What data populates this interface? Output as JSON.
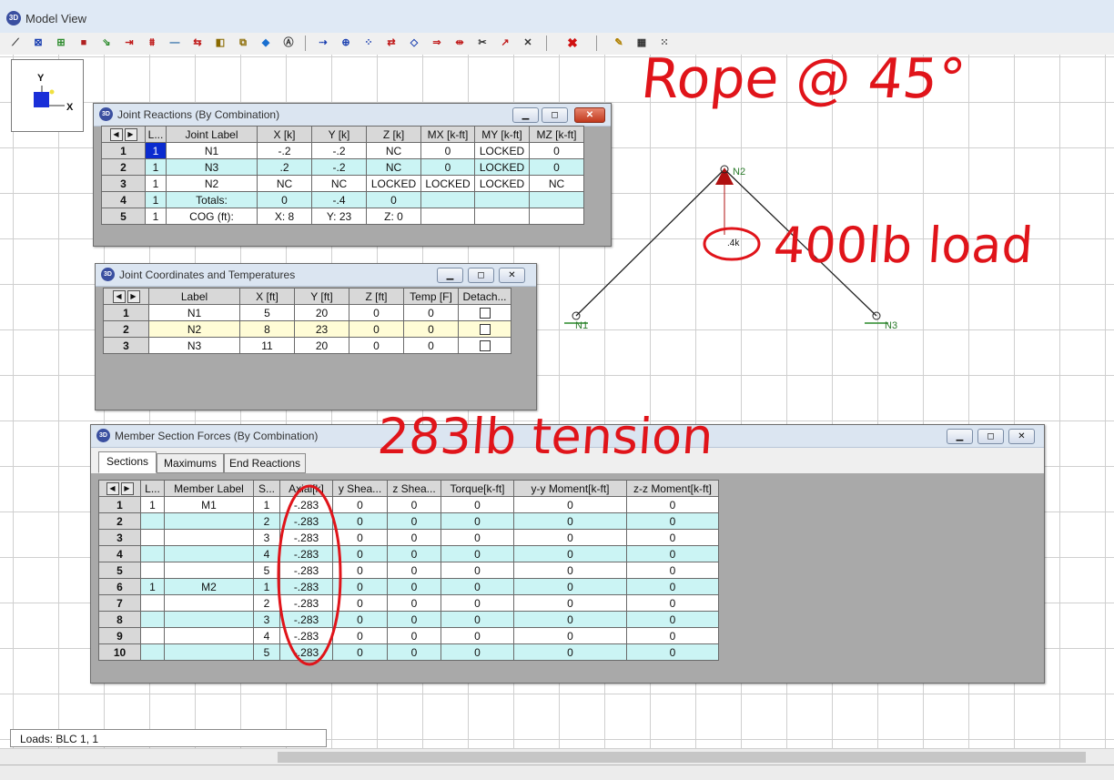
{
  "window": {
    "title": "Model View"
  },
  "colors": {
    "accent": "#0a2bcf",
    "cyan_row": "#cbf4f4",
    "yellow_row": "#fffcd6",
    "annotation": "#e0141a",
    "load_arrow": "#b01010"
  },
  "toolbar": {
    "icons": [
      "draw-member-icon",
      "select-icon",
      "plate-icon",
      "solid-icon",
      "boundary-icon",
      "load-arrow-icon",
      "distributed-load-icon",
      "line-icon",
      "move-icon",
      "mirror-icon",
      "copy-icon",
      "render-icon",
      "snap-icon",
      "node-icon",
      "node-plus-icon",
      "joint-icon",
      "a-to-a-icon",
      "a-diamond-icon",
      "a-arrow-icon",
      "a-bar-icon",
      "scissors-icon",
      "wand-icon",
      "cross-icon",
      "delete-icon",
      "edit-icon",
      "grid-icon",
      "dot-grid-icon"
    ]
  },
  "axes": {
    "y": "Y",
    "x": "X"
  },
  "joint_reactions": {
    "title": "Joint Reactions (By Combination)",
    "columns": [
      "L...",
      "Joint Label",
      "X [k]",
      "Y [k]",
      "Z [k]",
      "MX [k-ft]",
      "MY [k-ft]",
      "MZ [k-ft]"
    ],
    "rows": [
      {
        "n": "1",
        "cells": [
          "1",
          "N1",
          "-.2",
          "-.2",
          "NC",
          "0",
          "LOCKED",
          "0"
        ]
      },
      {
        "n": "2",
        "cells": [
          "1",
          "N3",
          ".2",
          "-.2",
          "NC",
          "0",
          "LOCKED",
          "0"
        ]
      },
      {
        "n": "3",
        "cells": [
          "1",
          "N2",
          "NC",
          "NC",
          "LOCKED",
          "LOCKED",
          "LOCKED",
          "NC"
        ]
      },
      {
        "n": "4",
        "cells": [
          "1",
          "Totals:",
          "0",
          "-.4",
          "0",
          "",
          "",
          ""
        ]
      },
      {
        "n": "5",
        "cells": [
          "1",
          "COG (ft):",
          "X: 8",
          "Y: 23",
          "Z: 0",
          "",
          "",
          ""
        ]
      }
    ]
  },
  "joint_coords": {
    "title": "Joint Coordinates and Temperatures",
    "columns": [
      "Label",
      "X [ft]",
      "Y [ft]",
      "Z [ft]",
      "Temp [F]",
      "Detach..."
    ],
    "rows": [
      {
        "n": "1",
        "cells": [
          "N1",
          "5",
          "20",
          "0",
          "0"
        ],
        "detach": false
      },
      {
        "n": "2",
        "cells": [
          "N2",
          "8",
          "23",
          "0",
          "0"
        ],
        "detach": false
      },
      {
        "n": "3",
        "cells": [
          "N3",
          "11",
          "20",
          "0",
          "0"
        ],
        "detach": false
      }
    ]
  },
  "member_forces": {
    "title": "Member Section Forces (By Combination)",
    "tabs": [
      "Sections",
      "Maximums",
      "End Reactions"
    ],
    "columns": [
      "L...",
      "Member Label",
      "S...",
      "Axial[k]",
      "y Shea...",
      "z Shea...",
      "Torque[k-ft]",
      "y-y Moment[k-ft]",
      "z-z Moment[k-ft]"
    ],
    "rows": [
      {
        "n": "1",
        "cells": [
          "1",
          "M1",
          "1",
          "-.283",
          "0",
          "0",
          "0",
          "0",
          "0"
        ]
      },
      {
        "n": "2",
        "cells": [
          "",
          "",
          "2",
          "-.283",
          "0",
          "0",
          "0",
          "0",
          "0"
        ]
      },
      {
        "n": "3",
        "cells": [
          "",
          "",
          "3",
          "-.283",
          "0",
          "0",
          "0",
          "0",
          "0"
        ]
      },
      {
        "n": "4",
        "cells": [
          "",
          "",
          "4",
          "-.283",
          "0",
          "0",
          "0",
          "0",
          "0"
        ]
      },
      {
        "n": "5",
        "cells": [
          "",
          "",
          "5",
          "-.283",
          "0",
          "0",
          "0",
          "0",
          "0"
        ]
      },
      {
        "n": "6",
        "cells": [
          "1",
          "M2",
          "1",
          "-.283",
          "0",
          "0",
          "0",
          "0",
          "0"
        ]
      },
      {
        "n": "7",
        "cells": [
          "",
          "",
          "2",
          "-.283",
          "0",
          "0",
          "0",
          "0",
          "0"
        ]
      },
      {
        "n": "8",
        "cells": [
          "",
          "",
          "3",
          "-.283",
          "0",
          "0",
          "0",
          "0",
          "0"
        ]
      },
      {
        "n": "9",
        "cells": [
          "",
          "",
          "4",
          "-.283",
          "0",
          "0",
          "0",
          "0",
          "0"
        ]
      },
      {
        "n": "10",
        "cells": [
          "",
          "",
          "5",
          "-.283",
          "0",
          "0",
          "0",
          "0",
          "0"
        ]
      }
    ]
  },
  "model": {
    "nodes": [
      "N1",
      "N2",
      "N3"
    ],
    "load_label": ".4k"
  },
  "annotations": {
    "rope": "Rope @ 45°",
    "load": "400lb load",
    "tension": "283lb tension"
  },
  "status": {
    "loads": "Loads: BLC 1, 1"
  }
}
